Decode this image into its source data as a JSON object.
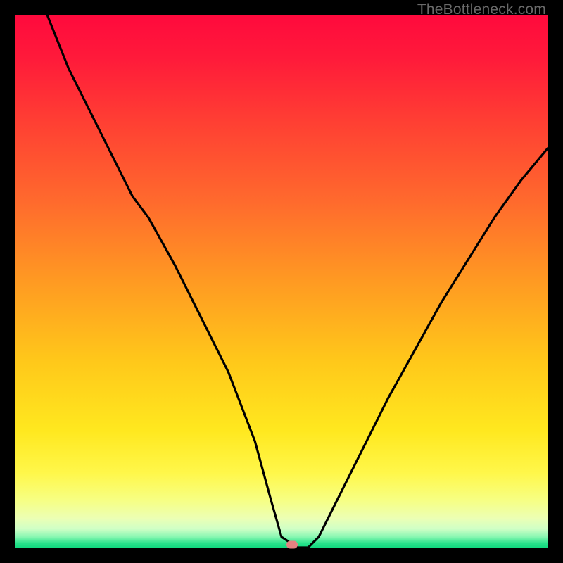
{
  "watermark": "TheBottleneck.com",
  "marker": {
    "x_pct": 52.0,
    "y_pct": 99.5
  },
  "colors": {
    "gradient_stops": [
      {
        "offset": 0.0,
        "color": "#ff0a3d"
      },
      {
        "offset": 0.08,
        "color": "#ff1a3a"
      },
      {
        "offset": 0.2,
        "color": "#ff3f33"
      },
      {
        "offset": 0.35,
        "color": "#ff6a2d"
      },
      {
        "offset": 0.5,
        "color": "#ff9a22"
      },
      {
        "offset": 0.65,
        "color": "#ffc81a"
      },
      {
        "offset": 0.78,
        "color": "#ffe81f"
      },
      {
        "offset": 0.86,
        "color": "#fff74a"
      },
      {
        "offset": 0.91,
        "color": "#f7ff82"
      },
      {
        "offset": 0.945,
        "color": "#ecffb4"
      },
      {
        "offset": 0.965,
        "color": "#cfffc6"
      },
      {
        "offset": 0.98,
        "color": "#88f7b2"
      },
      {
        "offset": 0.992,
        "color": "#29e28b"
      },
      {
        "offset": 1.0,
        "color": "#12d97f"
      }
    ],
    "curve": "#000000",
    "marker": "#e48181"
  },
  "chart_data": {
    "type": "line",
    "title": "",
    "xlabel": "",
    "ylabel": "",
    "xlim": [
      0,
      100
    ],
    "ylim": [
      0,
      100
    ],
    "grid": false,
    "legend": "none",
    "series": [
      {
        "name": "bottleneck-curve",
        "x": [
          6,
          10,
          15,
          20,
          22,
          25,
          30,
          35,
          40,
          45,
          48,
          50,
          53,
          55,
          57,
          60,
          65,
          70,
          75,
          80,
          85,
          90,
          95,
          100
        ],
        "y": [
          100,
          90,
          80,
          70,
          66,
          62,
          53,
          43,
          33,
          20,
          9,
          2,
          0,
          0,
          2,
          8,
          18,
          28,
          37,
          46,
          54,
          62,
          69,
          75
        ]
      }
    ],
    "marker_point": {
      "x": 52,
      "y": 0
    }
  }
}
